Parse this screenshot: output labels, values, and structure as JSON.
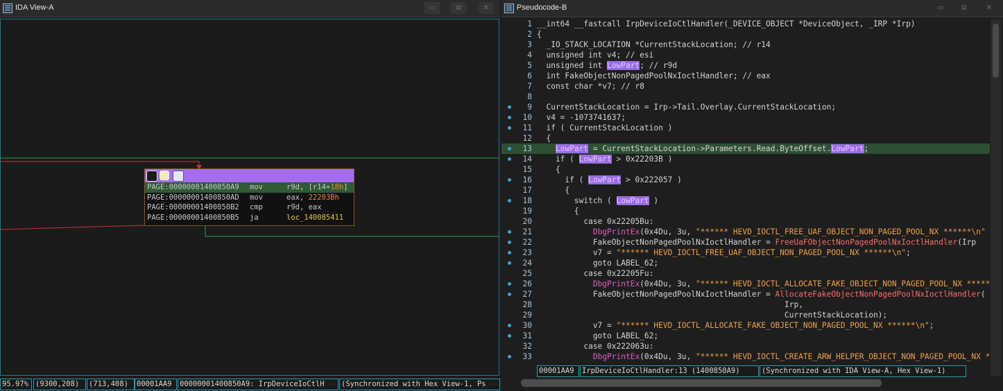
{
  "left": {
    "title": "IDA View-A",
    "block": [
      {
        "addr": "PAGE:00000001400850A9",
        "mnem": "mov",
        "op_a": "r9d, [r14+",
        "op_b": "18h",
        "op_c": "]",
        "selected": true
      },
      {
        "addr": "PAGE:00000001400850AD",
        "mnem": "mov",
        "op_a": "eax, ",
        "op_b": "22203Bh",
        "op_c": "",
        "selected": false
      },
      {
        "addr": "PAGE:00000001400850B2",
        "mnem": "cmp",
        "op_a": "r9d, eax",
        "op_b": "",
        "op_c": "",
        "selected": false
      },
      {
        "addr": "PAGE:00000001400850B5",
        "mnem": "ja",
        "op_a": "",
        "op_b": "",
        "op_c": "loc_140085411",
        "selected": false
      }
    ],
    "status": [
      "95.97%",
      "(9300,208)",
      "(713,408)",
      "00001AA9",
      "00000001400850A9: IrpDeviceIoCtlH",
      "(Synchronized with Hex View-1, Ps"
    ]
  },
  "right": {
    "title": "Pseudocode-B",
    "status": [
      "00001AA9",
      "IrpDeviceIoCtlHandler:13 (1400850A9)",
      "(Synchronized with IDA View-A, Hex View-1)"
    ]
  },
  "pseudocode": [
    {
      "n": "1",
      "dot": false,
      "hl": false,
      "segs": [
        [
          "t",
          "__int64 __fastcall IrpDeviceIoCtlHandler(_DEVICE_OBJECT *DeviceObject, _IRP *Irp)"
        ]
      ]
    },
    {
      "n": "2",
      "dot": false,
      "hl": false,
      "segs": [
        [
          "t",
          "{"
        ]
      ]
    },
    {
      "n": "3",
      "dot": false,
      "hl": false,
      "segs": [
        [
          "t",
          "  _IO_STACK_LOCATION *CurrentStackLocation; // r14"
        ]
      ]
    },
    {
      "n": "4",
      "dot": false,
      "hl": false,
      "segs": [
        [
          "t",
          "  unsigned int v4; // esi"
        ]
      ]
    },
    {
      "n": "5",
      "dot": false,
      "hl": false,
      "segs": [
        [
          "t",
          "  unsigned int "
        ],
        [
          "v",
          "LowPart"
        ],
        [
          "t",
          "; // r9d"
        ]
      ]
    },
    {
      "n": "6",
      "dot": false,
      "hl": false,
      "segs": [
        [
          "t",
          "  int FakeObjectNonPagedPoolNxIoctlHandler; // eax"
        ]
      ]
    },
    {
      "n": "7",
      "dot": false,
      "hl": false,
      "segs": [
        [
          "t",
          "  const char *v7; // r8"
        ]
      ]
    },
    {
      "n": "8",
      "dot": false,
      "hl": false,
      "segs": [
        [
          "t",
          ""
        ]
      ]
    },
    {
      "n": "9",
      "dot": true,
      "hl": false,
      "segs": [
        [
          "t",
          "  CurrentStackLocation = Irp->Tail.Overlay.CurrentStackLocation;"
        ]
      ]
    },
    {
      "n": "10",
      "dot": true,
      "hl": false,
      "segs": [
        [
          "t",
          "  v4 = -1073741637;"
        ]
      ]
    },
    {
      "n": "11",
      "dot": true,
      "hl": false,
      "segs": [
        [
          "t",
          "  if ( CurrentStackLocation )"
        ]
      ]
    },
    {
      "n": "12",
      "dot": false,
      "hl": false,
      "segs": [
        [
          "t",
          "  {"
        ]
      ]
    },
    {
      "n": "13",
      "dot": true,
      "hl": true,
      "segs": [
        [
          "t",
          "    "
        ],
        [
          "v",
          "LowPart"
        ],
        [
          "t",
          " = CurrentStackLocation->Parameters.Read.ByteOffset."
        ],
        [
          "v",
          "LowPart"
        ],
        [
          "t",
          ";"
        ]
      ]
    },
    {
      "n": "14",
      "dot": true,
      "hl": false,
      "segs": [
        [
          "t",
          "    if ( "
        ],
        [
          "v",
          "LowPart"
        ],
        [
          "t",
          " > 0x22203B )"
        ]
      ]
    },
    {
      "n": "15",
      "dot": false,
      "hl": false,
      "segs": [
        [
          "t",
          "    {"
        ]
      ]
    },
    {
      "n": "16",
      "dot": true,
      "hl": false,
      "segs": [
        [
          "t",
          "      if ( "
        ],
        [
          "v",
          "LowPart"
        ],
        [
          "t",
          " > 0x222057 )"
        ]
      ]
    },
    {
      "n": "17",
      "dot": false,
      "hl": false,
      "segs": [
        [
          "t",
          "      {"
        ]
      ]
    },
    {
      "n": "18",
      "dot": true,
      "hl": false,
      "segs": [
        [
          "t",
          "        switch ( "
        ],
        [
          "v",
          "LowPart"
        ],
        [
          "t",
          " )"
        ]
      ]
    },
    {
      "n": "19",
      "dot": false,
      "hl": false,
      "segs": [
        [
          "t",
          "        {"
        ]
      ]
    },
    {
      "n": "20",
      "dot": false,
      "hl": false,
      "segs": [
        [
          "t",
          "          case 0x22205Bu:"
        ]
      ]
    },
    {
      "n": "21",
      "dot": true,
      "hl": false,
      "segs": [
        [
          "t",
          "            "
        ],
        [
          "f",
          "DbgPrintEx"
        ],
        [
          "t",
          "(0x4Du, 3u, "
        ],
        [
          "s",
          "\"****** HEVD_IOCTL_FREE_UAF_OBJECT_NON_PAGED_POOL_NX ******\\n\""
        ]
      ]
    },
    {
      "n": "22",
      "dot": true,
      "hl": false,
      "segs": [
        [
          "t",
          "            FakeObjectNonPagedPoolNxIoctlHandler = "
        ],
        [
          "r",
          "FreeUaFObjectNonPagedPoolNxIoctlHandler"
        ],
        [
          "t",
          "(Irp"
        ]
      ]
    },
    {
      "n": "23",
      "dot": true,
      "hl": false,
      "segs": [
        [
          "t",
          "            v7 = "
        ],
        [
          "s",
          "\"****** HEVD_IOCTL_FREE_UAF_OBJECT_NON_PAGED_POOL_NX ******\\n\""
        ],
        [
          "t",
          ";"
        ]
      ]
    },
    {
      "n": "24",
      "dot": true,
      "hl": false,
      "segs": [
        [
          "t",
          "            goto LABEL_62;"
        ]
      ]
    },
    {
      "n": "25",
      "dot": false,
      "hl": false,
      "segs": [
        [
          "t",
          "          case 0x22205Fu:"
        ]
      ]
    },
    {
      "n": "26",
      "dot": true,
      "hl": false,
      "segs": [
        [
          "t",
          "            "
        ],
        [
          "f",
          "DbgPrintEx"
        ],
        [
          "t",
          "(0x4Du, 3u, "
        ],
        [
          "s",
          "\"****** HEVD_IOCTL_ALLOCATE_FAKE_OBJECT_NON_PAGED_POOL_NX ******\\n\""
        ]
      ]
    },
    {
      "n": "27",
      "dot": true,
      "hl": false,
      "segs": [
        [
          "t",
          "            FakeObjectNonPagedPoolNxIoctlHandler = "
        ],
        [
          "r",
          "AllocateFakeObjectNonPagedPoolNxIoctlHandler"
        ],
        [
          "t",
          "("
        ]
      ]
    },
    {
      "n": "28",
      "dot": false,
      "hl": false,
      "segs": [
        [
          "t",
          "                                                     Irp,"
        ]
      ]
    },
    {
      "n": "29",
      "dot": false,
      "hl": false,
      "segs": [
        [
          "t",
          "                                                     CurrentStackLocation);"
        ]
      ]
    },
    {
      "n": "30",
      "dot": true,
      "hl": false,
      "segs": [
        [
          "t",
          "            v7 = "
        ],
        [
          "s",
          "\"****** HEVD_IOCTL_ALLOCATE_FAKE_OBJECT_NON_PAGED_POOL_NX ******\\n\""
        ],
        [
          "t",
          ";"
        ]
      ]
    },
    {
      "n": "31",
      "dot": true,
      "hl": false,
      "segs": [
        [
          "t",
          "            goto LABEL_62;"
        ]
      ]
    },
    {
      "n": "32",
      "dot": false,
      "hl": false,
      "segs": [
        [
          "t",
          "          case 0x222063u:"
        ]
      ]
    },
    {
      "n": "33",
      "dot": true,
      "hl": false,
      "segs": [
        [
          "t",
          "            "
        ],
        [
          "f",
          "DbgPrintEx"
        ],
        [
          "t",
          "(0x4Du, 3u, "
        ],
        [
          "s",
          "\"****** HEVD_IOCTL_CREATE_ARW_HELPER_OBJECT_NON_PAGED_POOL_NX ******\\n\""
        ]
      ]
    }
  ],
  "colors": {
    "accent": "#a56cf0",
    "highlight_line": "#2f4f33",
    "status_border": "#2a9cb5",
    "string": "#f0a14a",
    "function": "#e05cc1"
  },
  "icons": [
    "window-list-icon",
    "restore-icon",
    "close-icon",
    "graph-overview-icon",
    "edit-icon",
    "chart-icon"
  ]
}
